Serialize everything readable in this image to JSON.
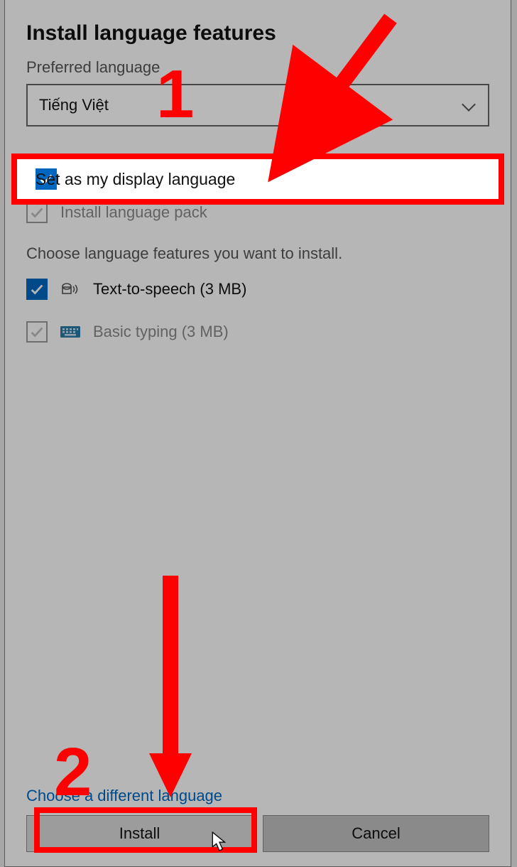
{
  "dialog": {
    "title": "Install language features",
    "preferred_label": "Preferred language",
    "dropdown_value": "Tiếng Việt",
    "option_display": "Set as my display language",
    "option_pack": "Install language pack",
    "choose_features": "Choose language features you want to install.",
    "feature_tts": "Text-to-speech (3 MB)",
    "feature_typing": "Basic typing (3 MB)",
    "link_diff": "Choose a different language",
    "btn_install": "Install",
    "btn_cancel": "Cancel"
  },
  "annotations": {
    "num1": "1",
    "num2": "2"
  },
  "colors": {
    "accent": "#0067c0",
    "annotation": "#ff0000"
  }
}
